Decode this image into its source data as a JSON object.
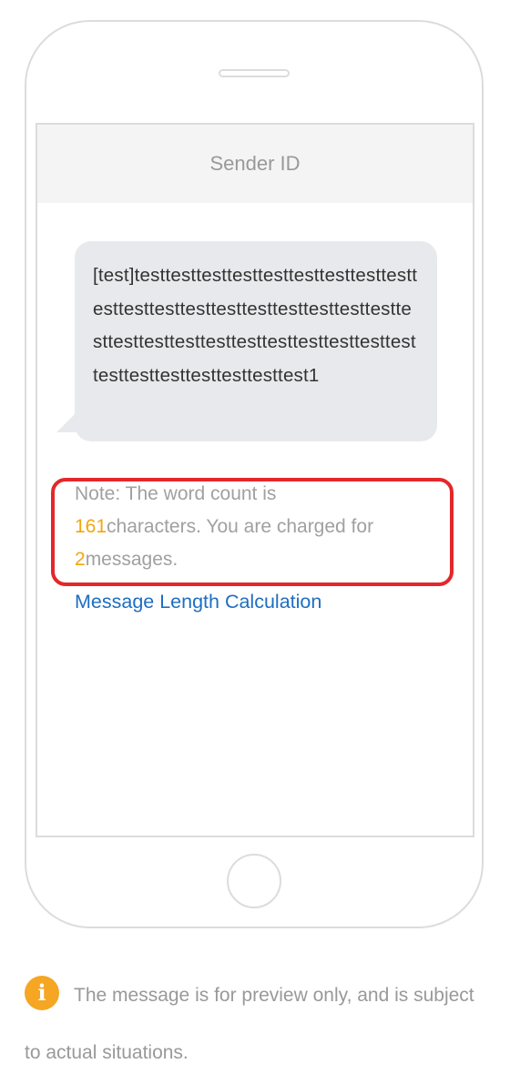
{
  "screen": {
    "header": {
      "sender_id": "Sender ID"
    },
    "message": {
      "text": "[test]testtesttesttesttesttesttesttesttesttesttesttesttesttesttesttesttesttesttesttesttesttesttesttesttesttesttesttesttesttesttesttesttesttesttesttesttest1"
    },
    "note": {
      "prefix": "Note: The word count is",
      "char_count": "161",
      "middle": "characters. You are charged for",
      "message_count": "2",
      "suffix": "messages."
    },
    "link": {
      "label": "Message Length Calculation"
    }
  },
  "footer": {
    "icon": "info-icon",
    "icon_glyph": "i",
    "text": "The message is for preview only, and is subject to actual situations."
  },
  "colors": {
    "highlight_number": "#f2a60d",
    "note_border": "#e4272a",
    "link": "#1d6ec2",
    "info_icon": "#f5a623"
  }
}
